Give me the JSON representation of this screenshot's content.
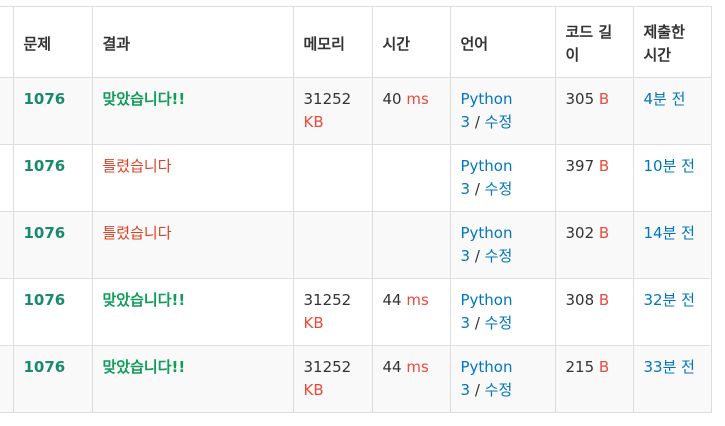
{
  "headers": {
    "problem": "문제",
    "result": "결과",
    "memory": "메모리",
    "time": "시간",
    "language": "언어",
    "code_length_line1": "코드 길",
    "code_length_line2": "이",
    "submitted_line1": "제출한",
    "submitted_line2": "시간"
  },
  "rows": [
    {
      "problem": "1076",
      "result": "맞았습니다!!",
      "status": "ac",
      "memory": "31252",
      "memory_unit": "KB",
      "time": "40",
      "time_unit": "ms",
      "lang": "Python",
      "lang2": "3",
      "edit": "수정",
      "length": "305",
      "length_unit": "B",
      "submitted": "4분 전"
    },
    {
      "problem": "1076",
      "result": "틀렸습니다",
      "status": "wa",
      "memory": "",
      "memory_unit": "",
      "time": "",
      "time_unit": "",
      "lang": "Python",
      "lang2": "3",
      "edit": "수정",
      "length": "397",
      "length_unit": "B",
      "submitted": "10분 전"
    },
    {
      "problem": "1076",
      "result": "틀렸습니다",
      "status": "wa",
      "memory": "",
      "memory_unit": "",
      "time": "",
      "time_unit": "",
      "lang": "Python",
      "lang2": "3",
      "edit": "수정",
      "length": "302",
      "length_unit": "B",
      "submitted": "14분 전"
    },
    {
      "problem": "1076",
      "result": "맞았습니다!!",
      "status": "ac",
      "memory": "31252",
      "memory_unit": "KB",
      "time": "44",
      "time_unit": "ms",
      "lang": "Python",
      "lang2": "3",
      "edit": "수정",
      "length": "308",
      "length_unit": "B",
      "submitted": "32분 전"
    },
    {
      "problem": "1076",
      "result": "맞았습니다!!",
      "status": "ac",
      "memory": "31252",
      "memory_unit": "KB",
      "time": "44",
      "time_unit": "ms",
      "lang": "Python",
      "lang2": "3",
      "edit": "수정",
      "length": "215",
      "length_unit": "B",
      "submitted": "33분 전"
    }
  ],
  "colors": {
    "accepted": "#0f9d58",
    "wrong": "#dd4124",
    "unit": "#e74c3c",
    "link": "#0076c0",
    "problem": "#1a8a6e"
  }
}
